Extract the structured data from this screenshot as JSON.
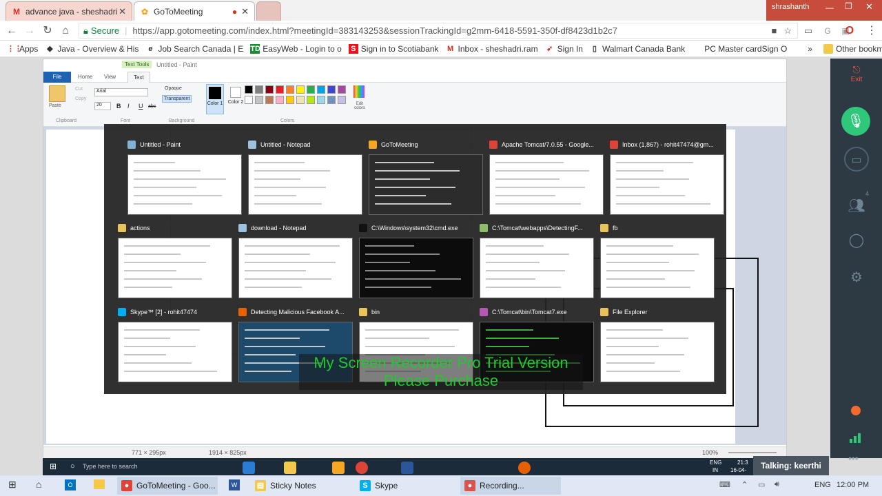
{
  "browser": {
    "tabs": [
      {
        "title": "advance java - sheshadri",
        "icon": "gmail-icon"
      },
      {
        "title": "GoToMeeting",
        "icon": "gotomeeting-icon"
      }
    ],
    "user": "shrashanth",
    "secure_label": "Secure",
    "url": "https://app.gotomeeting.com/index.html?meetingId=383143253&sessionTrackingId=g2mm-6418-5591-350f-df8423d1b2c7",
    "bookmarks": [
      "Apps",
      "Java - Overview & His",
      "Job Search Canada | E",
      "EasyWeb - Login to o",
      "Sign in to Scotiabank",
      "Inbox - sheshadri.ram",
      "Sign In",
      "Walmart Canada Bank",
      "PC Master cardSign O"
    ],
    "other_bookmarks": "Other bookmarks",
    "more": "»"
  },
  "paint": {
    "title": "Untitled - Paint",
    "text_tools": "Text Tools",
    "tabs": [
      "File",
      "Home",
      "View",
      "Text"
    ],
    "clipboard": {
      "paste": "Paste",
      "cut": "Cut",
      "copy": "Copy",
      "group": "Clipboard"
    },
    "font": {
      "name": "Arial",
      "size": "20",
      "group": "Font",
      "b": "B",
      "i": "I",
      "u": "U",
      "s": "abc"
    },
    "background": {
      "opaque": "Opaque",
      "transparent": "Transparent",
      "group": "Background"
    },
    "colors": {
      "color1": "Color 1",
      "color2": "Color 2",
      "edit": "Edit colors",
      "group": "Colors"
    },
    "status": {
      "selection": "771 × 295px",
      "size": "1914 × 825px",
      "zoom": "100%"
    }
  },
  "switcher": {
    "windows": [
      {
        "title": "Untitled - Paint",
        "color": "#7fb2d6"
      },
      {
        "title": "Untitled - Notepad",
        "color": "#9cc2e0"
      },
      {
        "title": "GoToMeeting",
        "color": "#f5a623"
      },
      {
        "title": "Apache Tomcat/7.0.55 - Google...",
        "color": "#db4437"
      },
      {
        "title": "Inbox (1,867) - rohit47474@gm...",
        "color": "#db4437"
      },
      {
        "title": "actions",
        "color": "#e8c25b"
      },
      {
        "title": "download - Notepad",
        "color": "#9cc2e0"
      },
      {
        "title": "C:\\Windows\\system32\\cmd.exe",
        "color": "#111111"
      },
      {
        "title": "C:\\Tomcat\\webapps\\DetectingF...",
        "color": "#8fbc6b"
      },
      {
        "title": "fb",
        "color": "#e8c25b"
      },
      {
        "title": "Skype™ [2] - rohit47474",
        "color": "#00aff0"
      },
      {
        "title": "Detecting Malicious Facebook A...",
        "color": "#e66000"
      },
      {
        "title": "bin",
        "color": "#e8c25b"
      },
      {
        "title": "C:\\Tomcat\\bin\\Tomcat7.exe",
        "color": "#b25ab2"
      },
      {
        "title": "File Explorer",
        "color": "#e8c25b"
      }
    ]
  },
  "watermark": {
    "line1": "My Screen Recorder Pro Trial Version",
    "line2": "Please Purchase"
  },
  "gotomeeting": {
    "exit": "Exit",
    "attendees": "4",
    "talking": "Talking: keerthi"
  },
  "inner_taskbar": {
    "search": "Type here to search",
    "lang": "ENG",
    "region": "IN",
    "time": "21:3",
    "date": "16-04-"
  },
  "taskbar": {
    "items": [
      {
        "label": "GoToMeeting - Goo...",
        "color": "#db4437"
      },
      {
        "label": "Sticky Notes",
        "color": "#f2c94c"
      },
      {
        "label": "Skype",
        "color": "#00aff0"
      },
      {
        "label": "Recording...",
        "color": "#d9534f"
      }
    ],
    "lang": "ENG",
    "time": "12:00 PM"
  },
  "palette": [
    "#000000",
    "#7f7f7f",
    "#880015",
    "#ed1c24",
    "#ff7f27",
    "#fff200",
    "#22b14c",
    "#00a2e8",
    "#3f48cc",
    "#a349a4",
    "#ffffff",
    "#c3c3c3",
    "#b97a57",
    "#ffaec9",
    "#ffc90e",
    "#efe4b0",
    "#b5e61d",
    "#99d9ea",
    "#7092be",
    "#c8bfe7"
  ]
}
